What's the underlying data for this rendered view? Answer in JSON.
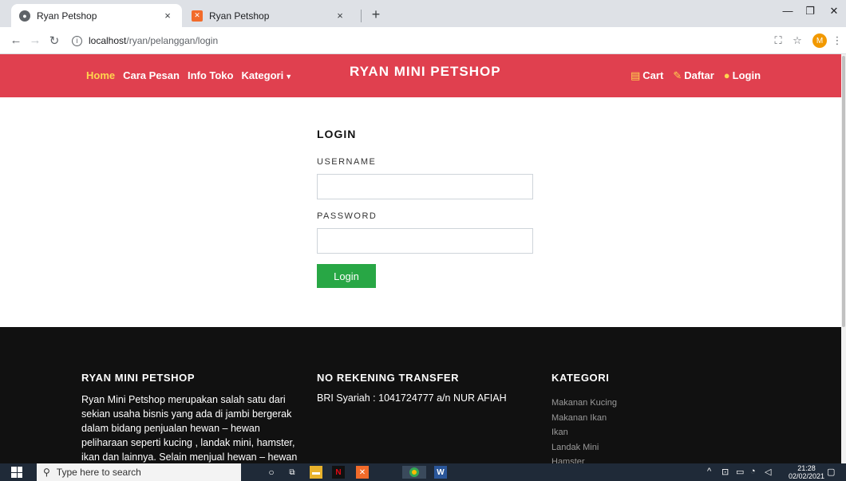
{
  "browser": {
    "tabs": [
      {
        "title": "Ryan Petshop",
        "close": "×"
      },
      {
        "title": "Ryan Petshop",
        "close": "×"
      }
    ],
    "new_tab": "+",
    "url_host": "localhost",
    "url_path": "/ryan/pelanggan/login",
    "avatar_letter": "M"
  },
  "navbar": {
    "links": [
      "Home",
      "Cara Pesan",
      "Info Toko",
      "Kategori"
    ],
    "brand": "RYAN MINI PETSHOP",
    "right_links": [
      "Cart",
      "Daftar",
      "Login"
    ],
    "color": "#e0404f",
    "active_color": "#ffd54f"
  },
  "login": {
    "title": "LOGIN",
    "username_label": "USERNAME",
    "password_label": "PASSWORD",
    "username_value": "",
    "password_value": "",
    "button_label": "Login",
    "button_color": "#28a745"
  },
  "footer": {
    "col1": {
      "heading": "RYAN MINI PETSHOP",
      "text": "Ryan Mini Petshop merupakan salah satu dari sekian usaha bisnis yang ada di jambi bergerak dalam bidang penjualan hewan – hewan peliharaan seperti kucing , landak mini, hamster, ikan dan lainnya. Selain menjual hewan – hewan"
    },
    "col2": {
      "heading": "NO REKENING TRANSFER",
      "text": "BRI Syariah : 1041724777 a/n NUR AFIAH"
    },
    "col3": {
      "heading": "KATEGORI",
      "items": [
        "Makanan Kucing",
        "Makanan Ikan",
        "Ikan",
        "Landak Mini",
        "Hamster"
      ]
    }
  },
  "taskbar": {
    "search_placeholder": "Type here to search",
    "time": "21:28",
    "date": "02/02/2021"
  }
}
